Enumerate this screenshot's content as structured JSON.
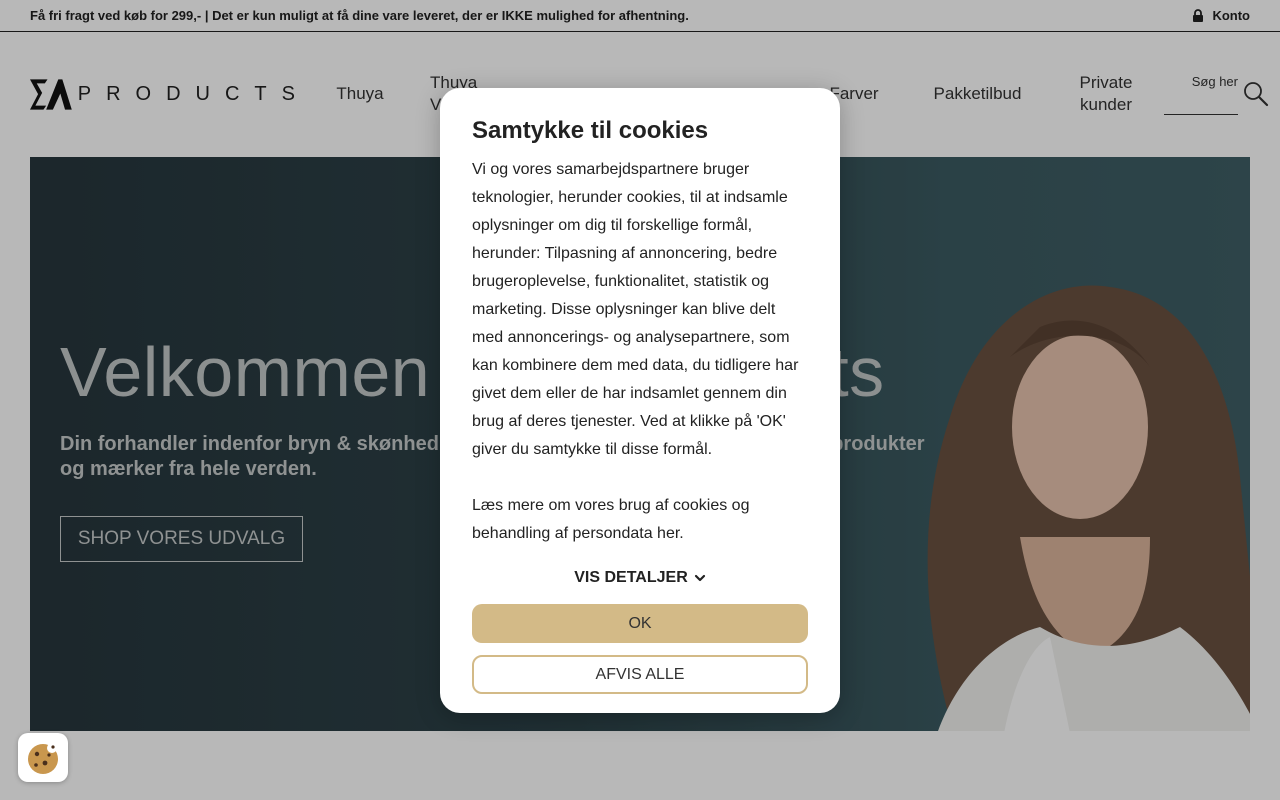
{
  "topbar": {
    "announcement": "Få fri fragt ved køb for 299,- | Det er kun muligt at få dine vare leveret, der er IKKE mulighed for afhentning.",
    "account_label": "Konto",
    "account_icon": "lock-icon"
  },
  "header": {
    "logo_text": "PRODUCTS",
    "nav": [
      {
        "label": "Thuya"
      },
      {
        "label": "Thuya V"
      },
      {
        "label": "Farver"
      },
      {
        "label": "Pakketilbud"
      },
      {
        "label": "Private kunder"
      }
    ],
    "search": {
      "placeholder": "Søg her",
      "icon": "search-icon"
    }
  },
  "hero": {
    "title": "Velkommen                    ts",
    "subtitle": "Din forhandler indenfor bryn & skønhed! V                                                                  produkter og mærker fra hele verden.",
    "cta_label": "SHOP VORES UDVALG",
    "background_color": "#2d4349"
  },
  "cookie_modal": {
    "title": "Samtykke til cookies",
    "body": "Vi og vores samarbejdspartnere bruger teknologier, herunder cookies, til at indsamle oplysninger om dig til forskellige formål, herunder: Tilpasning af annoncering, bedre brugeroplevelse, funktionalitet, statistik og marketing. Disse oplysninger kan blive delt med annoncerings- og analysepartnere, som kan kombinere dem med data, du tidligere har givet dem eller de har indsamlet gennem din brug af deres tjenester. Ved at klikke på 'OK' giver du samtykke til disse formål.",
    "link_text": "Læs mere om vores brug af cookies og behandling af persondata her.",
    "details_label": "VIS DETALJER",
    "ok_label": "OK",
    "reject_label": "AFVIS ALLE",
    "accent_color": "#d3ba87"
  },
  "cookie_fab": {
    "icon": "cookie-icon"
  }
}
